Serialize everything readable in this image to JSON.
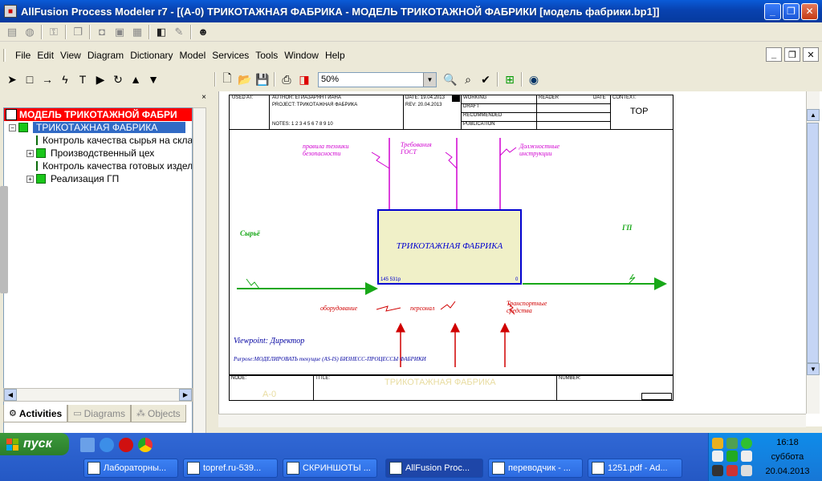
{
  "window": {
    "title": "AllFusion Process Modeler r7 - [(A-0) ТРИКОТАЖНАЯ ФАБРИКА - МОДЕЛЬ ТРИКОТАЖНОЙ ФАБРИКИ  [модель фабрики.bp1]]",
    "minimize": "_",
    "maximize": "❐",
    "close": "✕"
  },
  "menu": {
    "items": [
      "File",
      "Edit",
      "View",
      "Diagram",
      "Dictionary",
      "Model",
      "Services",
      "Tools",
      "Window",
      "Help"
    ]
  },
  "toolbar": {
    "zoom_value": "50%"
  },
  "explorer": {
    "root": "МОДЕЛЬ ТРИКОТАЖНОЙ ФАБРИ",
    "selected": "ТРИКОТАЖНАЯ ФАБРИКА",
    "children": [
      {
        "label": "Контроль качества  сырья на скла",
        "expandable": false
      },
      {
        "label": "Производственный цех",
        "expandable": true
      },
      {
        "label": "Контроль качества  готовых издел",
        "expandable": false
      },
      {
        "label": "Реализация ГП",
        "expandable": true
      }
    ],
    "tabs": [
      "Activities",
      "Diagrams",
      "Objects"
    ]
  },
  "diagram": {
    "header": {
      "used_at": "USED AT:",
      "author": "AUTHOR:  ЕГИАЗАРЯН ГИАНА",
      "project": "PROJECT:  ТРИКОТАЖНАЯ ФАБРИКА",
      "notes": "NOTES:  1  2  3  4  5  6  7  8  9  10",
      "date": "DATE: 19.04.2013",
      "rev": "REV:    20.04.2013",
      "working": "WORKING",
      "draft": "DRAFT",
      "recommended": "RECOMMENDED",
      "publication": "PUBLICATION",
      "reader": "READER",
      "date2": "DATE",
      "context": "CONTEXT:",
      "context_value": "TOP"
    },
    "box": {
      "title": "ТРИКОТАЖНАЯ ФАБРИКА",
      "cost": "145 531р",
      "number": "0"
    },
    "arrows": {
      "input": "Сырьё",
      "output": "ГП",
      "control1": "правила техники безопасности",
      "control2": "Требования ГОСТ",
      "control3": "Должностные инструкции",
      "mech1": "оборудование",
      "mech2": "персонал",
      "mech3": "Транспортные средства"
    },
    "viewpoint": "Viewpoint: Директор",
    "purpose": "Purpose:МОДЕЛИРОВАТЬ текущие (AS-IS) БИЗНЕСС-ПРОЦЕССЫ ФАБРИКИ",
    "footer": {
      "node_label": "NODE:",
      "node_value": "A-0",
      "title_label": "TITLE:",
      "title_value": "ТРИКОТАЖНАЯ ФАБРИКА",
      "number_label": "NUMBER:"
    }
  },
  "taskbar": {
    "start": "пуск",
    "tasks": [
      "Лабораторны...",
      "topref.ru-539...",
      "СКРИНШОТЫ ...",
      "AllFusion Proc...",
      "переводчик - ...",
      "1251.pdf - Ad..."
    ],
    "time": "16:18",
    "day": "суббота",
    "date": "20.04.2013"
  },
  "colors": {
    "control": "#d000d0",
    "mechanism": "#d00000",
    "flow": "#18a818",
    "box_border": "#0000d0",
    "box_fill": "#f0f0c8"
  }
}
